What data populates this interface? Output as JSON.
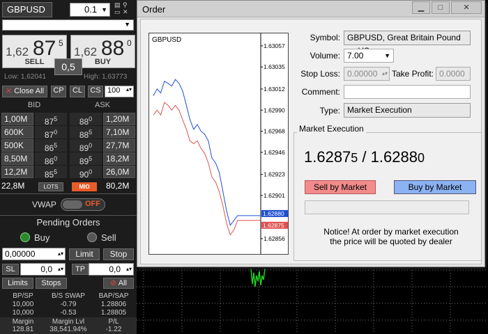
{
  "left_panel": {
    "symbol": "GBPUSD",
    "lot": "0.1",
    "sell": {
      "prefix": "1,62",
      "big": "87",
      "sup": "5",
      "label": "SELL"
    },
    "buy": {
      "prefix": "1,62",
      "big": "88",
      "sup": "0",
      "label": "BUY"
    },
    "spread": "0,5",
    "low": "Low: 1,62041",
    "high": "High: 1,63773",
    "close_all": "Close All",
    "cp": "CP",
    "cl": "CL",
    "cs": "CS",
    "cs_value": "100",
    "bid_header": "BID",
    "ask_header": "ASK",
    "depth": [
      {
        "bid_vol": "1,00M",
        "bid": "87",
        "bid_sup": "5",
        "ask": "88",
        "ask_sup": "0",
        "ask_vol": "1,20M"
      },
      {
        "bid_vol": "600K",
        "bid": "87",
        "bid_sup": "0",
        "ask": "88",
        "ask_sup": "5",
        "ask_vol": "7,10M"
      },
      {
        "bid_vol": "500K",
        "bid": "86",
        "bid_sup": "5",
        "ask": "89",
        "ask_sup": "0",
        "ask_vol": "27,7M"
      },
      {
        "bid_vol": "8,50M",
        "bid": "86",
        "bid_sup": "0",
        "ask": "89",
        "ask_sup": "5",
        "ask_vol": "18,2M"
      },
      {
        "bid_vol": "12,2M",
        "bid": "85",
        "bid_sup": "5",
        "ask": "90",
        "ask_sup": "0",
        "ask_vol": "26,0M"
      }
    ],
    "total_bid": "22,8M",
    "lots_label": "LOTS",
    "mio_label": "MIO",
    "total_ask": "80,2M",
    "vwap_label": "VWAP",
    "vwap_state": "OFF",
    "pending_title": "Pending Orders",
    "buy_radio": "Buy",
    "sell_radio": "Sell",
    "price_value": "0,00000",
    "limit_btn": "Limit",
    "stop_btn": "Stop",
    "sl_label": "SL",
    "sl_value": "0,0",
    "tp_label": "TP",
    "tp_value": "0,0",
    "limits_btn": "Limits",
    "stops_btn": "Stops",
    "all_btn": "All",
    "stats_headers": [
      "BP/SP",
      "B/S SWAP",
      "BAP/SAP"
    ],
    "stats_rows": [
      [
        "10,000",
        "-0.79",
        "1.28806"
      ],
      [
        "10,000",
        "-0.53",
        "1.28805"
      ]
    ],
    "footer_headers": [
      "Margin",
      "Margin Lvl",
      "P/L"
    ],
    "footer_values": [
      "128.81",
      "38,541.94%",
      "-1.22"
    ]
  },
  "dialog": {
    "title": "Order",
    "chart_symbol": "GBPUSD",
    "y_ticks": [
      "1.63057",
      "1.63035",
      "1.63012",
      "1.62990",
      "1.62968",
      "1.62946",
      "1.62923",
      "1.62901",
      "1.62856"
    ],
    "ask_tag": "1.62880",
    "bid_tag": "1.62875",
    "symbol_label": "Symbol:",
    "symbol_value": "GBPUSD, Great Britain Pound vs US",
    "volume_label": "Volume:",
    "volume_value": "7.00",
    "stoploss_label": "Stop Loss:",
    "stoploss_value": "0.00000",
    "takeprofit_label": "Take Profit:",
    "takeprofit_value": "0.0000",
    "comment_label": "Comment:",
    "comment_value": "",
    "type_label": "Type:",
    "type_value": "Market Execution",
    "group_title": "Market Execution",
    "bid_main": "1.6287",
    "bid_small": "5",
    "sep": " / ",
    "ask_main": "1.6288",
    "ask_small": "0",
    "sell_btn": "Sell by Market",
    "buy_btn": "Buy by Market",
    "notice_1": "Notice! At order by market execution",
    "notice_2": "the price will be quoted by dealer"
  },
  "colors": {
    "sell_button": "#f28b8b",
    "buy_button": "#8bb2f2",
    "bid_line": "#e05050",
    "ask_line": "#2050d0",
    "mio_badge": "#e85c2a"
  },
  "chart_data": {
    "type": "line",
    "title": "GBPUSD",
    "ylim": [
      1.6284,
      1.6307
    ],
    "series": [
      {
        "values": [
          1.63005,
          1.63012,
          1.63008,
          1.6302,
          1.63018,
          1.63015,
          1.63022,
          1.63018,
          1.6301,
          1.62995,
          1.6298,
          1.6297,
          1.62975,
          1.62968,
          1.62965,
          1.62958,
          1.6294,
          1.62935,
          1.62925,
          1.62905,
          1.62885,
          1.6287,
          1.62875,
          1.6288,
          1.6288
        ]
      },
      {
        "values": [
          1.62985,
          1.6299,
          1.62985,
          1.62998,
          1.62995,
          1.6299,
          1.62995,
          1.6299,
          1.6298,
          1.6297,
          1.62958,
          1.62955,
          1.62958,
          1.6295,
          1.62945,
          1.62935,
          1.6292,
          1.62915,
          1.62905,
          1.6289,
          1.62872,
          1.6286,
          1.62865,
          1.62875,
          1.62875
        ]
      }
    ]
  }
}
